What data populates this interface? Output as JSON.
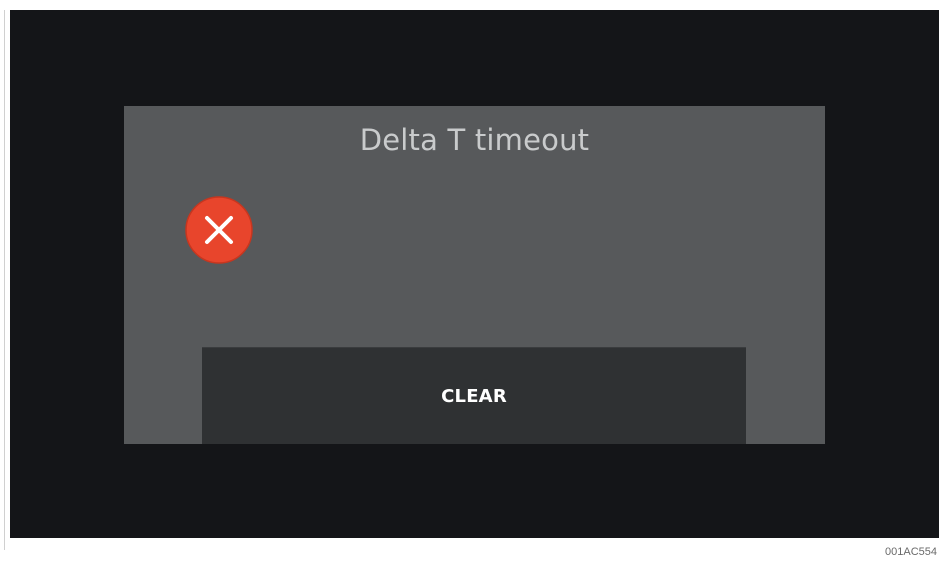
{
  "dialog": {
    "title": "Delta T timeout",
    "icon": "error-x-icon",
    "icon_color": "#e8452c",
    "clear_button_label": "CLEAR"
  },
  "colors": {
    "screen_background": "#141518",
    "dialog_background": "#57595b",
    "button_background": "#2f3133",
    "title_text": "#c9cbcc"
  },
  "figure_ref": "001AC554"
}
